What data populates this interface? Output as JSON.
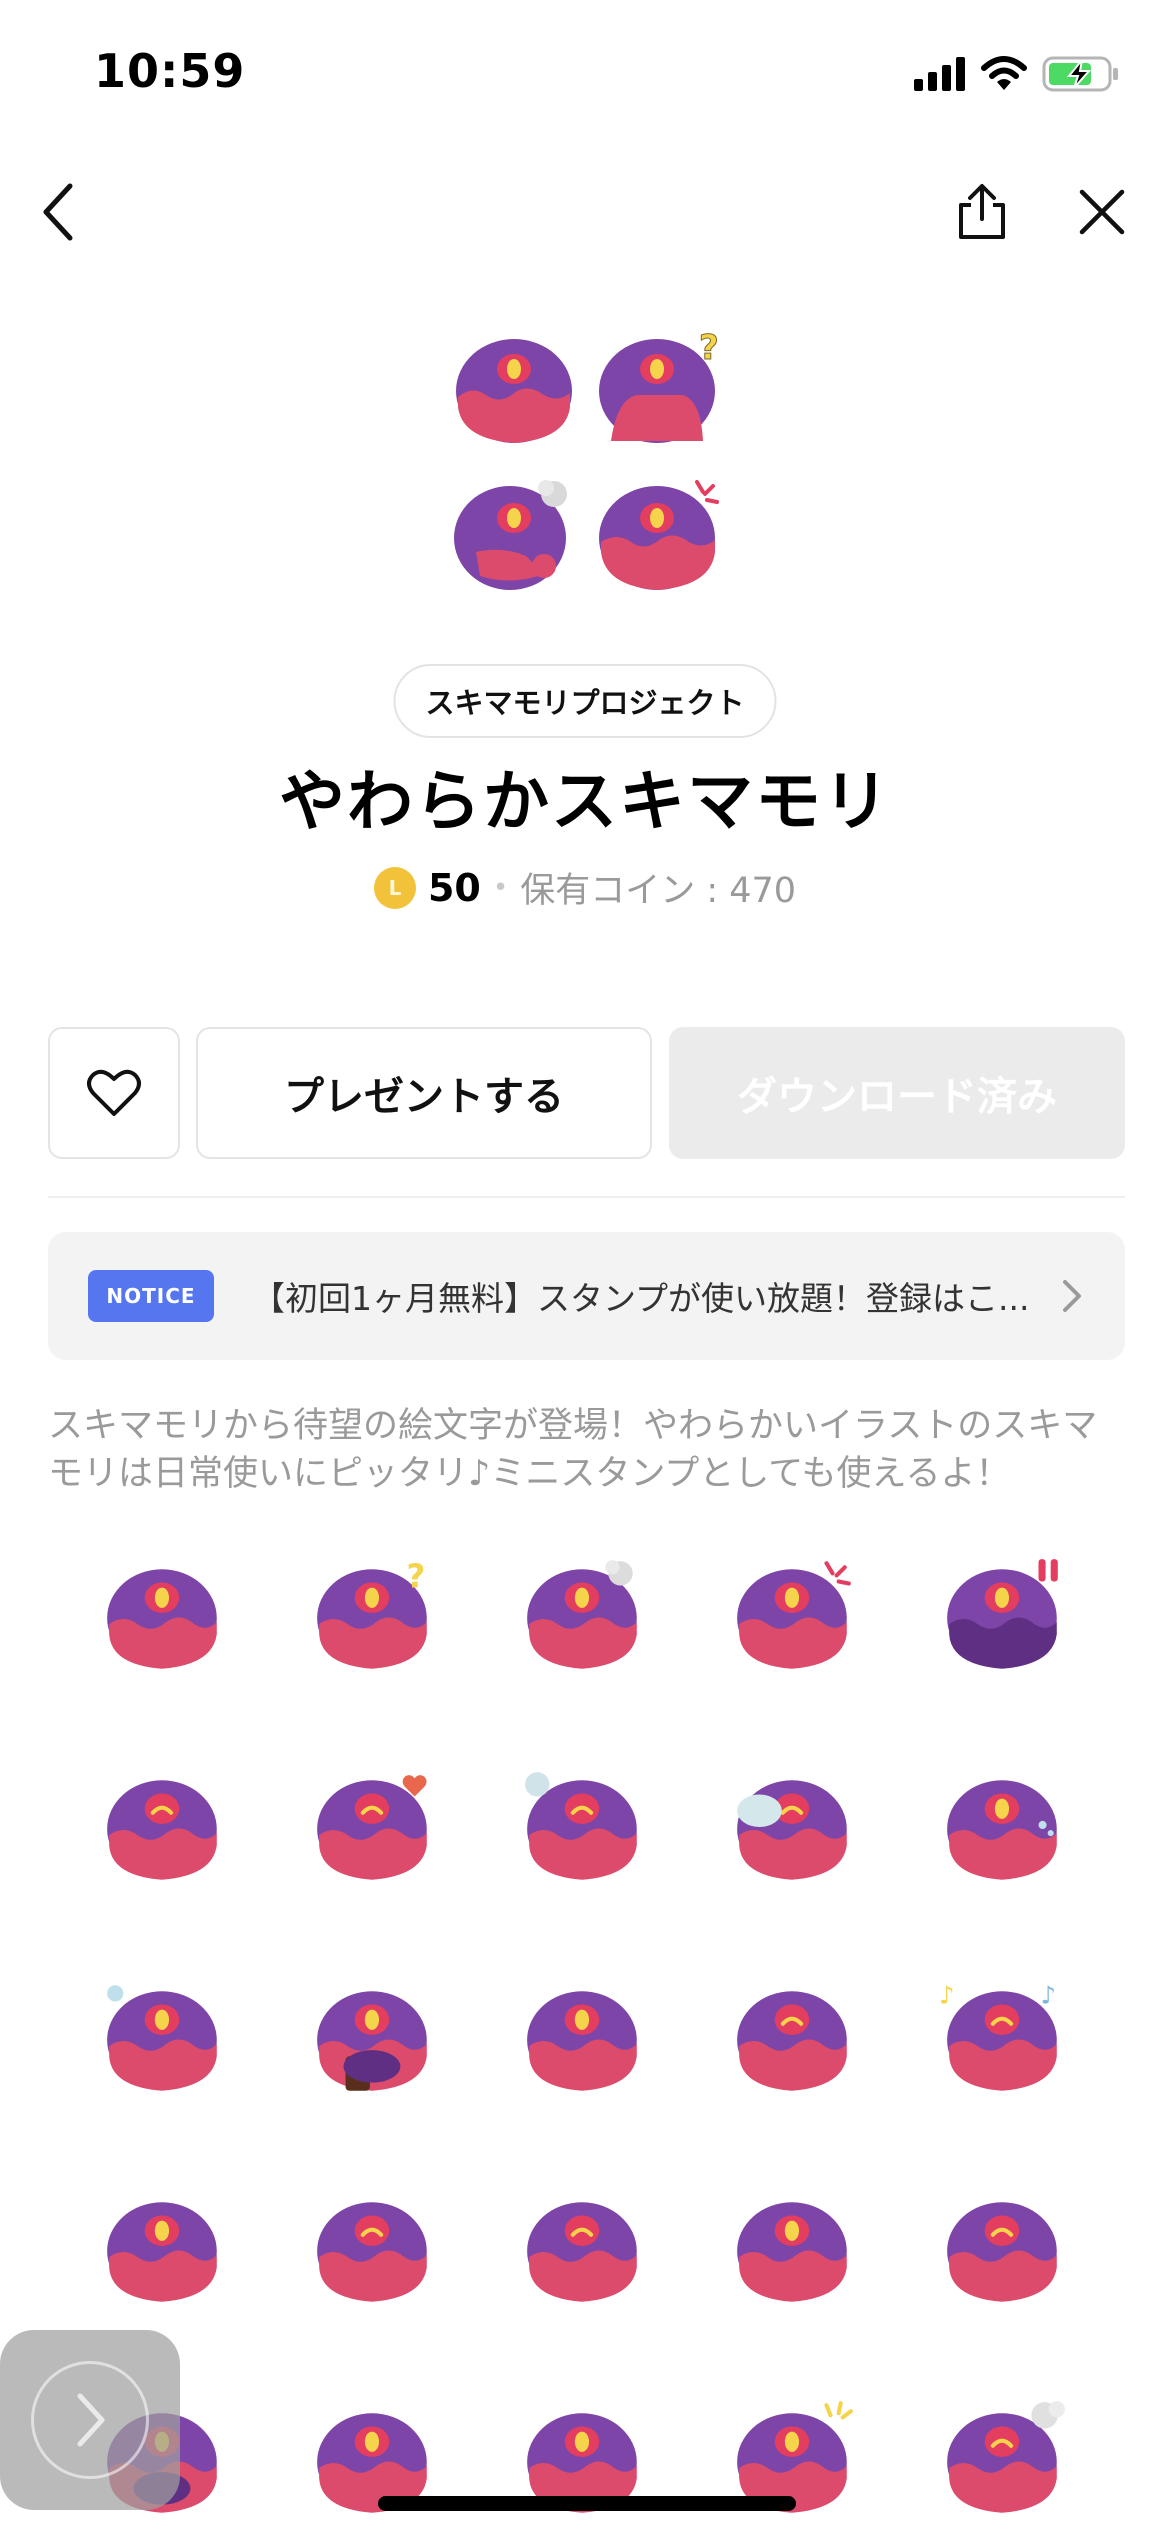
{
  "status_bar": {
    "time": "10:59",
    "icons": [
      "signal-icon",
      "wifi-icon",
      "battery-charging-icon"
    ],
    "battery_color": "#4cd964"
  },
  "nav": {
    "icons": [
      "back-chevron-icon",
      "share-icon",
      "close-icon"
    ]
  },
  "product": {
    "creator": "スキマモリプロジェクト",
    "title": "やわらかスキマモリ",
    "coin_symbol": "L",
    "price": "50",
    "price_separator": "•",
    "owned_coins": "保有コイン : 470"
  },
  "actions": {
    "gift_label": "プレゼントする",
    "download_label": "ダウンロード済み"
  },
  "notice": {
    "badge": "NOTICE",
    "text": "【初回1ヶ月無料】スタンプが使い放題！登録はこ..."
  },
  "description": "スキマモリから待望の絵文字が登場！やわらかいイラストのスキマモリは日常使いにピッタリ♪ミニスタンプとしても使えるよ！",
  "colors": {
    "body_purple": "#7e45a8",
    "body_pink": "#dc4b6c",
    "eye_outer": "#e33d5f",
    "eye_inner": "#f5d34b",
    "accent_blue": "#5576ee",
    "coin_gold": "#f2c23a"
  },
  "stickers": [
    {
      "variant": "neutral"
    },
    {
      "variant": "question"
    },
    {
      "variant": "thinking-cloud"
    },
    {
      "variant": "angry"
    },
    {
      "variant": "exclamation"
    },
    {
      "variant": "smile"
    },
    {
      "variant": "love"
    },
    {
      "variant": "wave"
    },
    {
      "variant": "sleepy"
    },
    {
      "variant": "sweat"
    },
    {
      "variant": "sad-drop"
    },
    {
      "variant": "chocolate"
    },
    {
      "variant": "hands"
    },
    {
      "variant": "happy-hands"
    },
    {
      "variant": "music"
    },
    {
      "variant": "wink"
    },
    {
      "variant": "blush"
    },
    {
      "variant": "cheer"
    },
    {
      "variant": "ears"
    },
    {
      "variant": "calm"
    },
    {
      "variant": "hidden"
    },
    {
      "variant": "tall"
    },
    {
      "variant": "shock"
    },
    {
      "variant": "sparkle"
    },
    {
      "variant": "steam"
    }
  ],
  "overlay": {
    "icons": [
      "floating-chevron-icon"
    ]
  }
}
